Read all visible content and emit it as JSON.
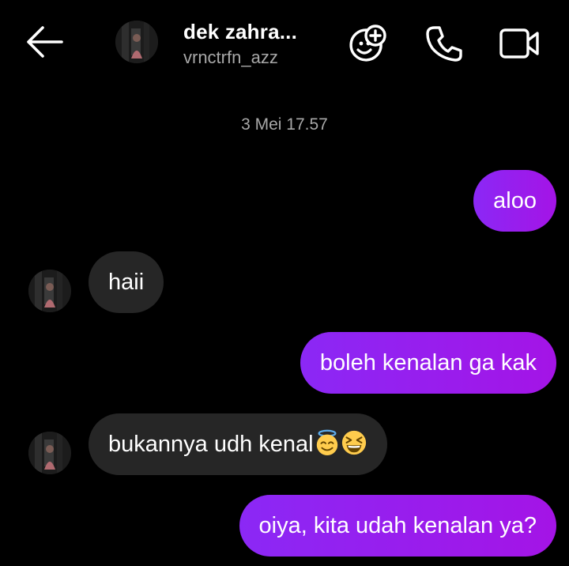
{
  "header": {
    "title": "dek zahra...",
    "username": "vrnctrfn_azz",
    "icons": [
      "back-arrow-icon",
      "add-people-icon",
      "phone-icon",
      "video-call-icon"
    ]
  },
  "conversation": {
    "timestamp": "3 Mei 17.57",
    "messages": [
      {
        "direction": "outgoing",
        "text": "aloo"
      },
      {
        "direction": "incoming",
        "text": "haii"
      },
      {
        "direction": "outgoing",
        "text": "boleh kenalan ga kak"
      },
      {
        "direction": "incoming",
        "text": "bukannya udh kenal",
        "emojis": [
          "smiling-face-with-halo-emoji",
          "grinning-squinting-face-emoji"
        ]
      },
      {
        "direction": "outgoing",
        "text": "oiya, kita udah kenalan ya?"
      }
    ]
  },
  "colors": {
    "background": "#000000",
    "outgoing_bubble": "#9b1cf0",
    "incoming_bubble": "#262626",
    "secondary_text": "#a8a8a8"
  }
}
